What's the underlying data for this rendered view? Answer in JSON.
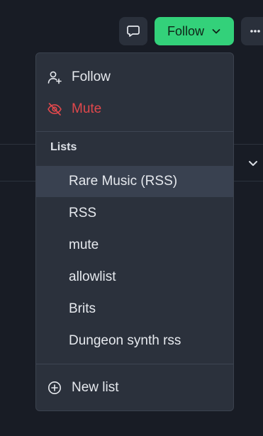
{
  "toolbar": {
    "message_icon": "message-bubble-icon",
    "follow_label": "Follow",
    "follow_chevron_icon": "chevron-down-icon",
    "more_icon": "ellipsis-icon"
  },
  "menu": {
    "follow_label": "Follow",
    "follow_icon": "user-plus-icon",
    "mute_label": "Mute",
    "mute_icon": "eye-off-icon",
    "lists_heading": "Lists",
    "lists": [
      {
        "label": "Rare Music (RSS)",
        "highlighted": true
      },
      {
        "label": "RSS"
      },
      {
        "label": "mute"
      },
      {
        "label": "allowlist"
      },
      {
        "label": "Brits"
      },
      {
        "label": "Dungeon synth rss"
      }
    ],
    "new_list_label": "New list",
    "new_list_icon": "plus-circle-icon"
  },
  "colors": {
    "accent": "#33d17a",
    "danger": "#e0484c",
    "menu_bg": "#2b313c",
    "page_bg": "#181c25"
  }
}
